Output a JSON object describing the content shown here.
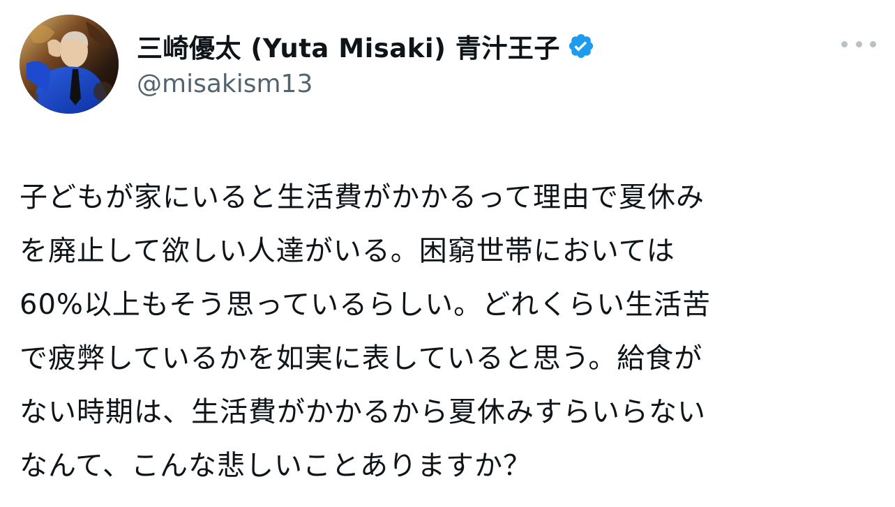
{
  "author": {
    "display_name": "三崎優太 (Yuta Misaki) 青汁王子",
    "handle": "@misakism13",
    "verified": true,
    "avatar": "profile-photo"
  },
  "icons": {
    "verified": "verified-badge-icon",
    "more": "more-options-icon"
  },
  "colors": {
    "verified_badge": "#1d9bf0",
    "handle_text": "#536471",
    "body_text": "#0f1419"
  },
  "tweet": {
    "lines": [
      "子どもが家にいると生活費がかかるって理由で夏休み",
      "を廃止して欲しい人達がいる。困窮世帯においては",
      "60%以上もそう思っているらしい。どれくらい生活苦",
      "で疲弊しているかを如実に表していると思う。給食が",
      "ない時期は、生活費がかかるから夏休みすらいらない",
      "なんて、こんな悲しいことありますか？"
    ]
  }
}
